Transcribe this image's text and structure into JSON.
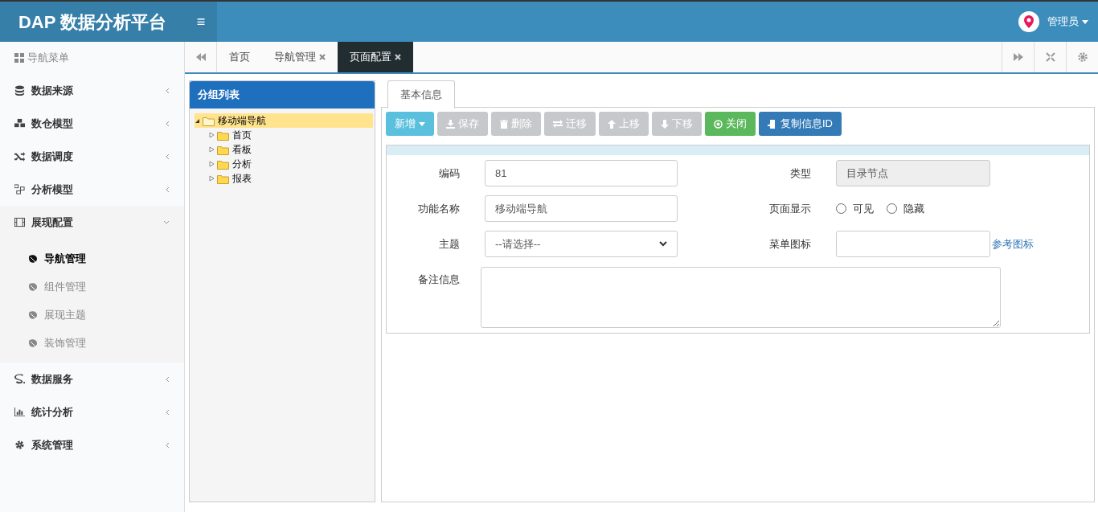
{
  "header": {
    "logo": "DAP 数据分析平台",
    "menu_toggle": "≡",
    "user": "管理员"
  },
  "sidebar": {
    "title": "导航菜单",
    "items": [
      {
        "label": "数据来源",
        "expanded": false
      },
      {
        "label": "数仓模型",
        "expanded": false
      },
      {
        "label": "数据调度",
        "expanded": false
      },
      {
        "label": "分析模型",
        "expanded": false
      },
      {
        "label": "展现配置",
        "expanded": true,
        "children": [
          {
            "label": "导航管理",
            "selected": true
          },
          {
            "label": "组件管理",
            "selected": false
          },
          {
            "label": "展现主题",
            "selected": false
          },
          {
            "label": "装饰管理",
            "selected": false
          }
        ]
      },
      {
        "label": "数据服务",
        "expanded": false
      },
      {
        "label": "统计分析",
        "expanded": false
      },
      {
        "label": "系统管理",
        "expanded": false
      }
    ]
  },
  "tabs": [
    {
      "label": "首页",
      "selected": false,
      "closable": false
    },
    {
      "label": "导航管理",
      "selected": false,
      "closable": true
    },
    {
      "label": "页面配置",
      "selected": true,
      "closable": true
    }
  ],
  "tree": {
    "title": "分组列表",
    "nodes": [
      {
        "label": "移动端导航",
        "expanded": true,
        "selected": true,
        "children": [
          {
            "label": "首页",
            "expanded": false,
            "selected": false
          },
          {
            "label": "看板",
            "expanded": false,
            "selected": false
          },
          {
            "label": "分析",
            "expanded": false,
            "selected": false
          },
          {
            "label": "报表",
            "expanded": false,
            "selected": false
          }
        ]
      }
    ]
  },
  "form": {
    "tabs": [
      {
        "label": "基本信息",
        "selected": true
      }
    ],
    "toolbar": [
      {
        "label": "新增",
        "kind": "info",
        "disabled": false,
        "dropdown": true
      },
      {
        "label": "保存",
        "kind": "default",
        "disabled": true,
        "dropdown": false
      },
      {
        "label": "删除",
        "kind": "default",
        "disabled": true,
        "dropdown": false
      },
      {
        "label": "迁移",
        "kind": "default",
        "disabled": true,
        "dropdown": false
      },
      {
        "label": "上移",
        "kind": "default",
        "disabled": true,
        "dropdown": false
      },
      {
        "label": "下移",
        "kind": "default",
        "disabled": true,
        "dropdown": false
      },
      {
        "label": "关闭",
        "kind": "success",
        "disabled": false,
        "dropdown": false
      },
      {
        "label": "复制信息ID",
        "kind": "primary",
        "disabled": false,
        "dropdown": false
      }
    ],
    "code": {
      "label": "编码",
      "value": "81"
    },
    "type": {
      "label": "类型",
      "value": "目录节点",
      "disabled": true
    },
    "name": {
      "label": "功能名称",
      "value": "移动端导航"
    },
    "display": {
      "label": "页面显示",
      "options": [
        {
          "label": "可见",
          "checked": false
        },
        {
          "label": "隐藏",
          "checked": false
        }
      ]
    },
    "theme": {
      "label": "主题",
      "value": "--请选择--"
    },
    "menu_icon": {
      "label": "菜单图标",
      "link": "参考图标"
    },
    "remark": {
      "label": "备注信息"
    }
  }
}
